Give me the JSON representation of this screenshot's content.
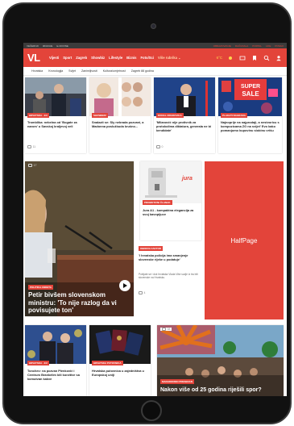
{
  "topstrip": {
    "left_items": [
      "VEČERNJI",
      "IZDANJE",
      "E-NOVINE"
    ],
    "right_items": [
      "OBRAZOVANJE",
      "RAČUNALA",
      "PORTAL",
      "LIFE",
      "POSAO"
    ]
  },
  "nav": {
    "logo": "VL",
    "items": [
      "Vijesti",
      "Sport",
      "Zagreb",
      "Showbiz",
      "Lifestyle",
      "Biznis",
      "Foto/Sci"
    ],
    "more": "Više rubrika ⌄",
    "temperature": "6°C",
    "colors": {
      "brand": "#e3443a",
      "dark": "#3b3b3b"
    }
  },
  "subnav": [
    "Hrvatska",
    "Kronologija",
    "Svijet",
    "Zanimljivosti",
    "Kultura/umjetnost",
    "Zagreb 88 godina"
  ],
  "top_row": [
    {
      "tag": "HRVATSKA · EU",
      "title": "Tromblika: nebelna od 'Bogate za narom' u Savskoj kraljevoj veli",
      "comments": "11"
    },
    {
      "tag": "SHOWBIZZ",
      "title": "Snalazit se: Sly nebrada pozvani, a Madonna poslužbuda krušno...",
      "comments": ""
    },
    {
      "tag": "DONAL DRADOVICA",
      "title": "'Milanović nije protivnik za protokolima diktatura, generala ne bi kendidate'",
      "comments": "0"
    },
    {
      "tag": "PLAKATI NAGRADA",
      "title": "Najnoprije na najprodaji, a nestvoricu s kompozicama ZG na svijet' Evo kako pomanjumo kupovinu slobinu vrišu",
      "comments": ""
    }
  ],
  "feature": {
    "tag": "POLITIKA ANKETA",
    "title": "Petir bivšem slovenskom ministru: 'To nije razlog da vi povisujete ton'",
    "comments": "17"
  },
  "juice": {
    "brand": "jura",
    "tag": "PROMOTIVNI ČLANAK",
    "title": "Jura A1 - kompaktna elegancija za svoj kavopijuce"
  },
  "ad": {
    "label": "HalfPage"
  },
  "small_story": {
    "tag": "OBNOVA FAKTOR",
    "title": "'I hrvatska policija ima smanjenje slovenske rijeke u podatuje'",
    "body": "Pobijate se i dok hrvatska Vlada Više sudje iz tra biti slovenske na Hrvatsku.",
    "comments": "4"
  },
  "bottom_row": [
    {
      "tag": "HRVATSKA · EU",
      "title": "Tonchev: na pozvan Plenković i Centrum Brankelim bili korzitive sa komutvan kakve",
      "comments": ""
    },
    {
      "tag": "HRVATSKA PUTOVNICA",
      "title": "Hrvatska putovnica u zajedništva u Europskoj uniji",
      "comments": ""
    },
    {
      "tag": "MAKEDONSKI PRESEDAN",
      "title": "Nakon više od 25 godina riješili spor?",
      "comments": "38"
    }
  ]
}
